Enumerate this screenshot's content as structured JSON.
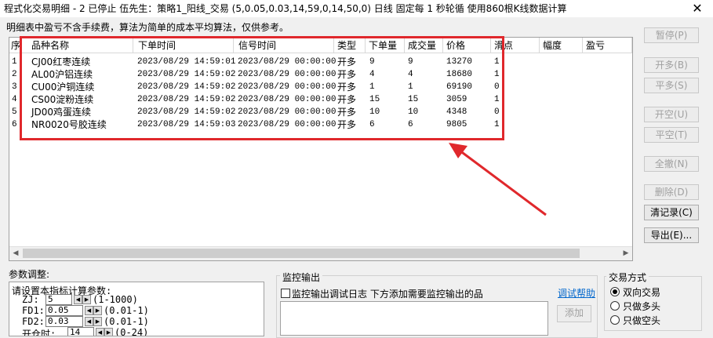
{
  "window": {
    "title": "程式化交易明细 - 2 已停止  伍先生：策略1_阳线_交易 (5,0.05,0.03,14,59,0,14,50,0) 日线 固定每 1 秒轮循 使用860根K线数据计算",
    "close_glyph": "X"
  },
  "info_text": "明细表中盈亏不含手续费，算法为简单的成本平均算法，仅供参考。",
  "table": {
    "headers": [
      "序",
      "品种名称",
      "下单时间",
      "信号时间",
      "类型",
      "下单量",
      "成交量",
      "价格",
      "滑点",
      "幅度",
      "盈亏"
    ],
    "rows": [
      {
        "idx": "1",
        "name": "CJ00红枣连续",
        "order_time": "2023/08/29 14:59:01",
        "signal_time": "2023/08/29 00:00:00",
        "type": "开多",
        "order_qty": "9",
        "fill_qty": "9",
        "price": "13270",
        "slip": "1"
      },
      {
        "idx": "2",
        "name": "AL00沪铝连续",
        "order_time": "2023/08/29 14:59:02",
        "signal_time": "2023/08/29 00:00:00",
        "type": "开多",
        "order_qty": "4",
        "fill_qty": "4",
        "price": "18680",
        "slip": "1"
      },
      {
        "idx": "3",
        "name": "CU00沪铜连续",
        "order_time": "2023/08/29 14:59:02",
        "signal_time": "2023/08/29 00:00:00",
        "type": "开多",
        "order_qty": "1",
        "fill_qty": "1",
        "price": "69190",
        "slip": "0"
      },
      {
        "idx": "4",
        "name": "CS00淀粉连续",
        "order_time": "2023/08/29 14:59:02",
        "signal_time": "2023/08/29 00:00:00",
        "type": "开多",
        "order_qty": "15",
        "fill_qty": "15",
        "price": "3059",
        "slip": "1"
      },
      {
        "idx": "5",
        "name": "JD00鸡蛋连续",
        "order_time": "2023/08/29 14:59:02",
        "signal_time": "2023/08/29 00:00:00",
        "type": "开多",
        "order_qty": "10",
        "fill_qty": "10",
        "price": "4348",
        "slip": "0"
      },
      {
        "idx": "6",
        "name": "NR0020号胶连续",
        "order_time": "2023/08/29 14:59:03",
        "signal_time": "2023/08/29 00:00:00",
        "type": "开多",
        "order_qty": "6",
        "fill_qty": "6",
        "price": "9805",
        "slip": "1"
      }
    ]
  },
  "buttons": {
    "pause": "暂停(P)",
    "open_long": "开多(B)",
    "close_long": "平多(S)",
    "open_short": "开空(U)",
    "close_short": "平空(T)",
    "cancel_all": "全撤(N)",
    "delete": "删除(D)",
    "clear_log": "清记录(C)",
    "export": "导出(E)..."
  },
  "params": {
    "section_label": "参数调整:",
    "heading": "请设置本指标计算参数:",
    "items": [
      {
        "name": "ZJ:",
        "value": "5",
        "range": "(1-1000)"
      },
      {
        "name": "FD1:",
        "value": "0.05",
        "range": "(0.01-1)"
      },
      {
        "name": "FD2:",
        "value": "0.03",
        "range": "(0.01-1)"
      },
      {
        "name": "开仓时:",
        "value": "14",
        "range": "(0-24)"
      }
    ]
  },
  "monitor": {
    "label": "监控输出",
    "checkbox_label": "监控输出调试日志 下方添加需要监控输出的品",
    "help_link": "调试帮助",
    "add_button": "添加"
  },
  "trade_mode": {
    "label": "交易方式",
    "options": [
      "双向交易",
      "只做多头",
      "只做空头"
    ],
    "selected": 0
  },
  "colors": {
    "highlight_box": "#e0282c",
    "arrow": "#e0282c",
    "link": "#0066cc"
  }
}
